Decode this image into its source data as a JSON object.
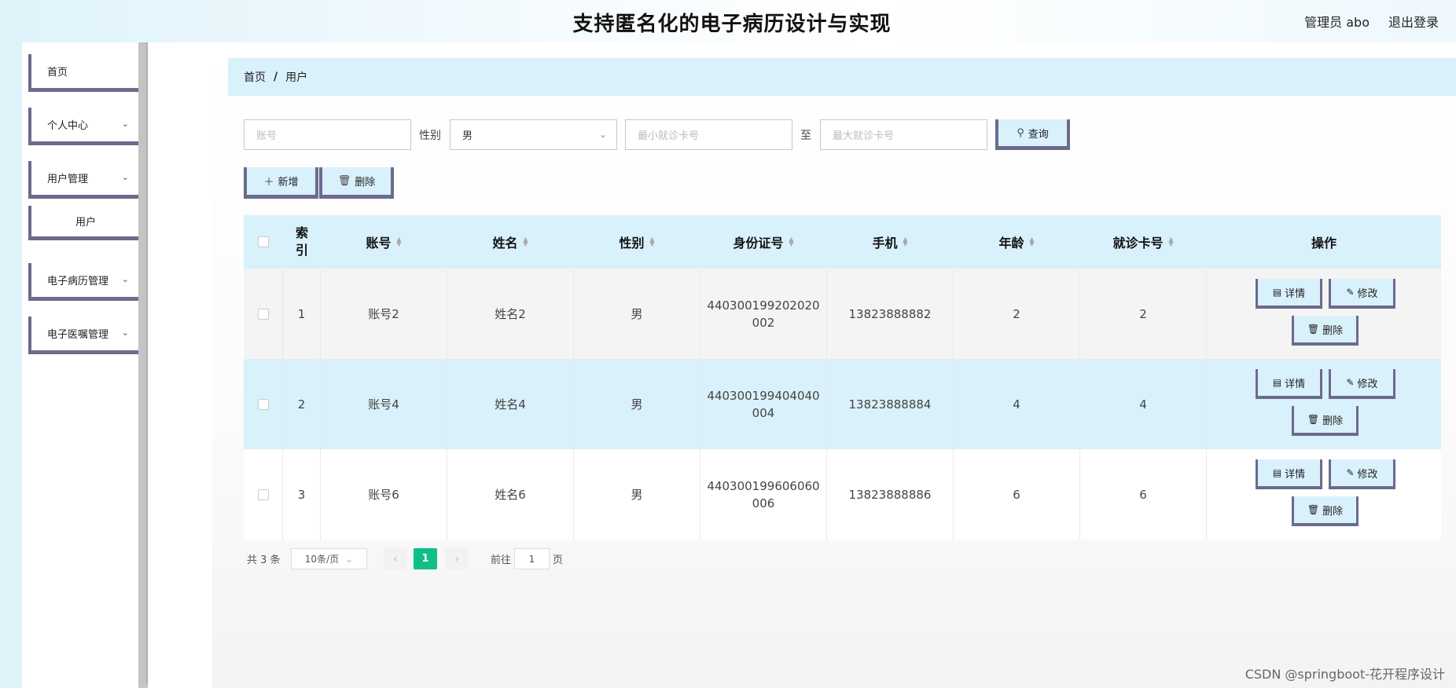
{
  "header": {
    "title": "支持匿名化的电子病历设计与实现",
    "user": "管理员 abo",
    "logout": "退出登录"
  },
  "sidebar": {
    "items": [
      {
        "label": "首页"
      },
      {
        "label": "个人中心"
      },
      {
        "label": "用户管理"
      },
      {
        "label": "用户"
      },
      {
        "label": "电子病历管理"
      },
      {
        "label": "电子医嘱管理"
      }
    ]
  },
  "breadcrumb": {
    "home": "首页",
    "sep": "/",
    "current": "用户"
  },
  "search": {
    "account_placeholder": "账号",
    "gender_label": "性别",
    "gender_value": "男",
    "min_card_placeholder": "最小就诊卡号",
    "to_label": "至",
    "max_card_placeholder": "最大就诊卡号",
    "query_button": "查询"
  },
  "toolbar": {
    "add_button": "新增",
    "delete_button": "删除"
  },
  "table": {
    "headers": {
      "index": "索引",
      "account": "账号",
      "name": "姓名",
      "gender": "性别",
      "id_number": "身份证号",
      "phone": "手机",
      "age": "年龄",
      "card": "就诊卡号",
      "actions": "操作"
    },
    "actions": {
      "detail": "详情",
      "edit": "修改",
      "delete": "删除"
    },
    "rows": [
      {
        "index": "1",
        "account": "账号2",
        "name": "姓名2",
        "gender": "男",
        "id_line1": "440300199202020",
        "id_line2": "002",
        "phone": "13823888882",
        "age": "2",
        "card": "2"
      },
      {
        "index": "2",
        "account": "账号4",
        "name": "姓名4",
        "gender": "男",
        "id_line1": "440300199404040",
        "id_line2": "004",
        "phone": "13823888884",
        "age": "4",
        "card": "4"
      },
      {
        "index": "3",
        "account": "账号6",
        "name": "姓名6",
        "gender": "男",
        "id_line1": "440300199606060",
        "id_line2": "006",
        "phone": "13823888886",
        "age": "6",
        "card": "6"
      }
    ]
  },
  "pagination": {
    "total": "共 3 条",
    "page_size": "10条/页",
    "current_page": "1",
    "goto_label": "前往",
    "goto_value": "1",
    "page_suffix": "页"
  },
  "watermark": "CSDN @springboot-花开程序设计",
  "colors": {
    "accent": "#d9f1fb",
    "border": "#6b6b8e",
    "page_active": "#0fbf87"
  }
}
